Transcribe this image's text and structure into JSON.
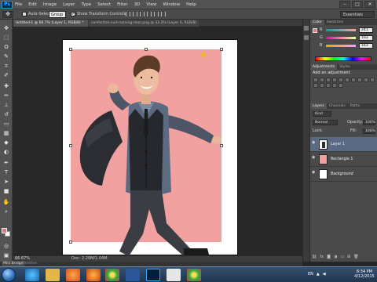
{
  "menubar": {
    "logo": "Ps",
    "menus": [
      "File",
      "Edit",
      "Image",
      "Layer",
      "Type",
      "Select",
      "Filter",
      "3D",
      "View",
      "Window",
      "Help"
    ],
    "window_controls": [
      "–",
      "□",
      "✕"
    ]
  },
  "options": {
    "tool_icon": "move-icon",
    "auto_select_label": "Auto-Select:",
    "auto_select_value": "Group",
    "show_transform_label": "Show Transform Controls",
    "workspace": "Essentials"
  },
  "tabs": [
    {
      "label": "Untitled-1 @ 66.7% (Layer 1, RGB/8) *"
    },
    {
      "label": "confection-suit-running-man.png @ 33.3% (Layer 0, RGB/8)"
    }
  ],
  "status": {
    "zoom": "66.67%",
    "doc_size": "Doc: 2.29M/1.04M"
  },
  "bottom_tabs": [
    "Mini Bridge",
    "Timeline"
  ],
  "panels": {
    "color_tabs": [
      "Color",
      "Swatches"
    ],
    "sliders": [
      {
        "label": "R",
        "value": "241"
      },
      {
        "label": "G",
        "value": "163"
      },
      {
        "label": "B",
        "value": "163"
      }
    ],
    "adjust_tabs": [
      "Adjustments",
      "Styles"
    ],
    "adjust_title": "Add an adjustment",
    "layers_tabs": [
      "Layers",
      "Channels",
      "Paths"
    ],
    "filter_kind": "Kind",
    "blend_mode": "Normal",
    "opacity_label": "Opacity:",
    "opacity_value": "100%",
    "lock_label": "Lock:",
    "fill_label": "Fill:",
    "fill_value": "100%",
    "layers": [
      {
        "name": "Layer 1",
        "selected": true
      },
      {
        "name": "Rectangle 1",
        "selected": false
      },
      {
        "name": "Background",
        "selected": false
      }
    ]
  },
  "colors": {
    "foreground": "#e2787c",
    "background": "#ffffff",
    "doc_rect": "#f1a2a0"
  },
  "taskbar": {
    "apps": [
      "ie-icon",
      "explorer-icon",
      "media-player-icon",
      "firefox-icon",
      "chrome-icon",
      "word-icon",
      "photoshop-icon",
      "paint-icon",
      "chrome-icon"
    ],
    "language": "EN",
    "time": "8:34 PM",
    "date": "4/12/2015"
  }
}
